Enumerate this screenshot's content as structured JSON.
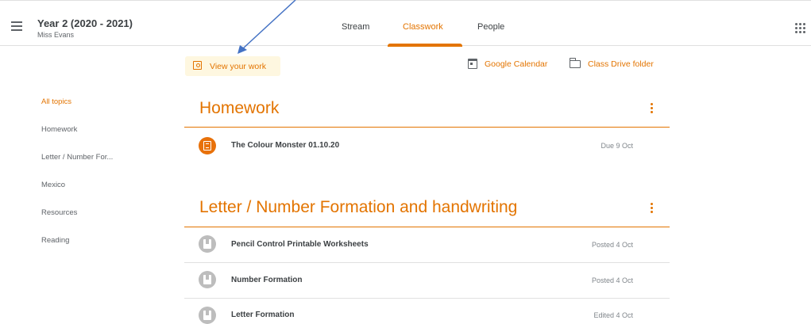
{
  "header": {
    "class_name": "Year 2 (2020 - 2021)",
    "teacher": "Miss Evans",
    "tabs": [
      {
        "label": "Stream"
      },
      {
        "label": "Classwork"
      },
      {
        "label": "People"
      }
    ]
  },
  "actions": {
    "view_work": "View your work",
    "calendar": "Google Calendar",
    "drive": "Class Drive folder"
  },
  "topics": [
    "All topics",
    "Homework",
    "Letter / Number For...",
    "Mexico",
    "Resources",
    "Reading"
  ],
  "sections": [
    {
      "title": "Homework",
      "items": [
        {
          "title": "The Colour Monster 01.10.20",
          "meta": "Due 9 Oct"
        }
      ]
    },
    {
      "title": "Letter / Number Formation and handwriting",
      "items": [
        {
          "title": "Pencil Control Printable Worksheets",
          "meta": "Posted 4 Oct"
        },
        {
          "title": "Number Formation",
          "meta": "Posted 4 Oct"
        },
        {
          "title": "Letter Formation",
          "meta": "Edited 4 Oct"
        }
      ]
    }
  ],
  "colors": {
    "accent": "#e37400",
    "arrow": "#4472c4"
  }
}
